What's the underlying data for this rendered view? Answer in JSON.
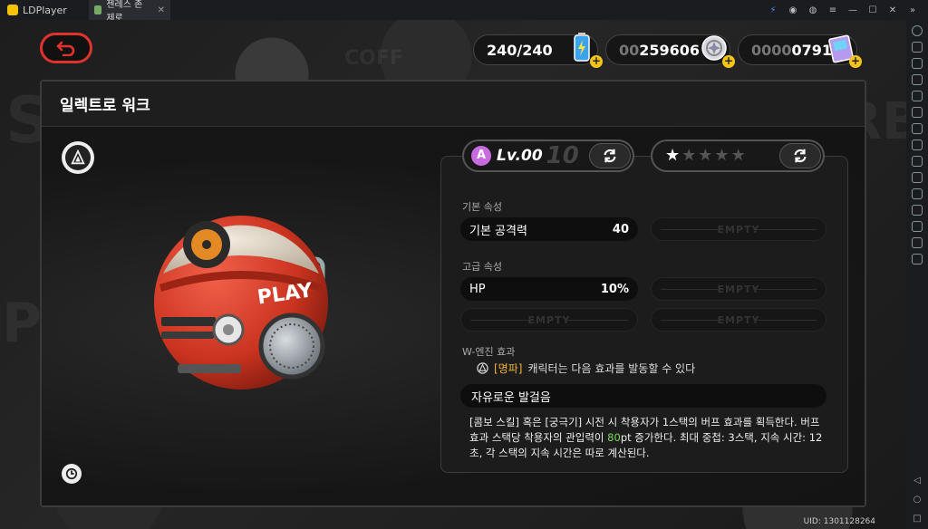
{
  "emulator": {
    "app_name": "LDPlayer",
    "tab_title": "젠레스 존 제로",
    "tab_close": "✕"
  },
  "currency": {
    "stamina": "240/240",
    "coins_prefix": "00",
    "coins": "259606",
    "polychrome_prefix": "0000",
    "polychrome": "0791",
    "plus": "+"
  },
  "panel": {
    "title": "일렉트로 워크"
  },
  "level": {
    "badge": "A",
    "current": "Lv.00",
    "max": "10"
  },
  "stars": {
    "filled": 1,
    "total": 5
  },
  "base_stats": {
    "title": "기본 속성",
    "rows": [
      {
        "name": "기본 공격력",
        "value": "40"
      }
    ],
    "empty_label": "EMPTY"
  },
  "advanced_stats": {
    "title": "고급 속성",
    "rows": [
      {
        "name": "HP",
        "value": "10%"
      }
    ],
    "empty_label": "EMPTY"
  },
  "engine_effect": {
    "title": "W-엔진 효과",
    "tag": "[명파]",
    "condition": "캐릭터는 다음 효과를 발동할 수 있다",
    "skill_name": "자유로운 발걸음",
    "desc_part1": "[콤보 스킬] 혹은 [궁극기] 시전 시 착용자가 1스택의 버프 효과를 획득한다. 버프 효과 스택당 착용자의 관입력이 ",
    "desc_highlight": "80",
    "desc_part2": "pt 증가한다. 최대 중첩: 3스택, 지속 시간: 12초, 각 스택의 지속 시간은 따로 계산된다."
  },
  "footer": {
    "uid": "UID: 1301128264"
  },
  "colors": {
    "accent_red": "#e0332b",
    "highlight_orange": "#f2b13b",
    "highlight_green": "#7ed957",
    "plus_yellow": "#f6c416"
  }
}
